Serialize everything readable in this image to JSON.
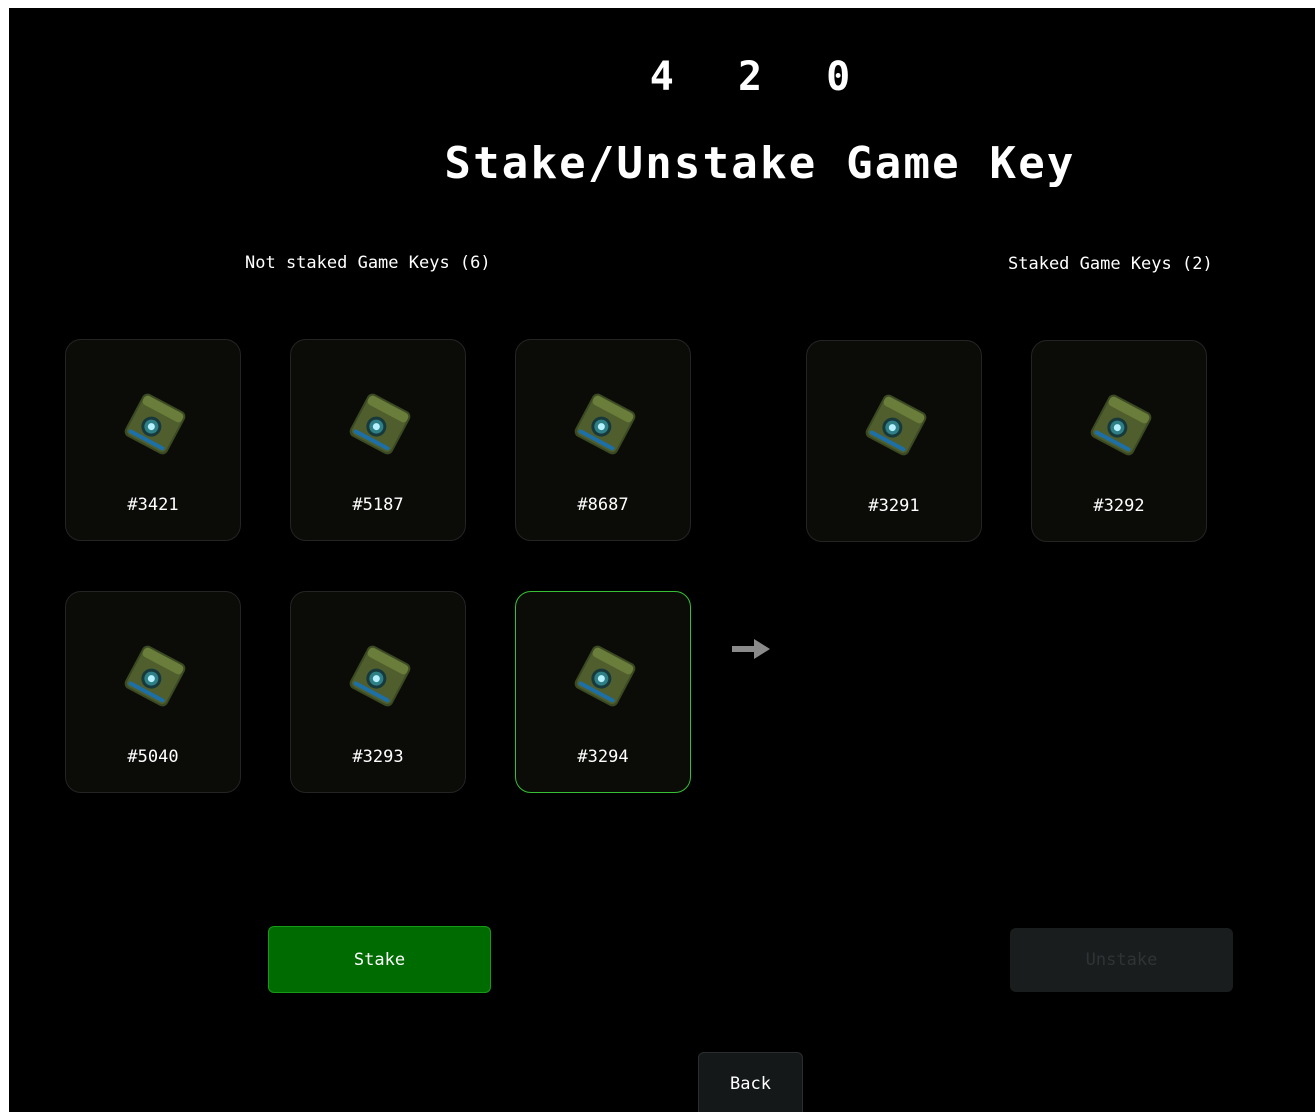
{
  "header": {
    "counter": "4 2 0",
    "title": "Stake/Unstake Game Key"
  },
  "not_staked": {
    "label": "Not staked Game Keys (6)",
    "keys": [
      {
        "id": "#3421",
        "selected": false
      },
      {
        "id": "#5187",
        "selected": false
      },
      {
        "id": "#8687",
        "selected": false
      },
      {
        "id": "#5040",
        "selected": false
      },
      {
        "id": "#3293",
        "selected": false
      },
      {
        "id": "#3294",
        "selected": true
      }
    ]
  },
  "staked": {
    "label": "Staked Game Keys (2)",
    "keys": [
      {
        "id": "#3291",
        "selected": false
      },
      {
        "id": "#3292",
        "selected": false
      }
    ]
  },
  "transfer_icon": "arrow-right-icon",
  "actions": {
    "stake_label": "Stake",
    "unstake_label": "Unstake",
    "back_label": "Back"
  },
  "colors": {
    "background": "#000000",
    "card_background": "#0b0c08",
    "selected_border": "#35c035",
    "stake_button": "#006b00",
    "disabled_button": "#1a1d1e"
  }
}
